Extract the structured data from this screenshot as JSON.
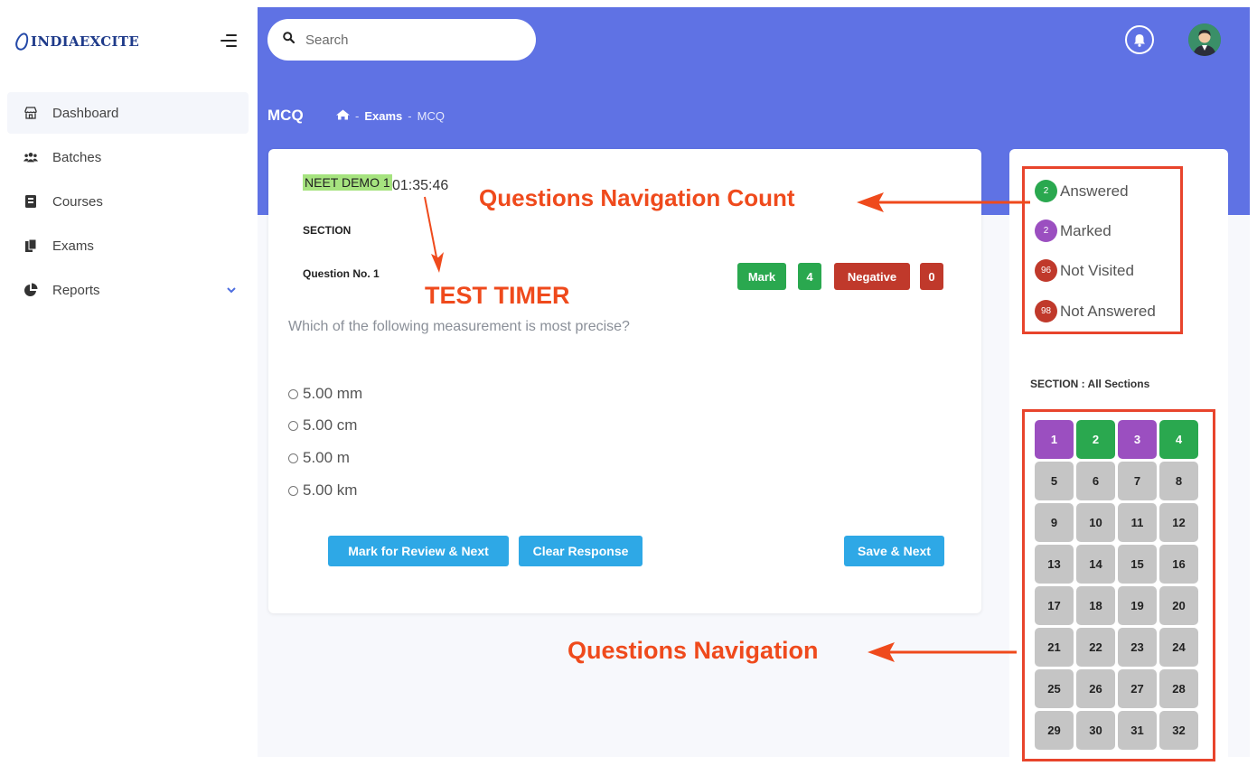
{
  "brand": {
    "name": "INDIAEXCITE"
  },
  "sidebar": {
    "items": [
      {
        "label": "Dashboard",
        "icon": "shop-icon"
      },
      {
        "label": "Batches",
        "icon": "users-icon"
      },
      {
        "label": "Courses",
        "icon": "book-icon"
      },
      {
        "label": "Exams",
        "icon": "copy-icon"
      },
      {
        "label": "Reports",
        "icon": "pie-chart-icon"
      }
    ]
  },
  "search": {
    "placeholder": "Search"
  },
  "header": {
    "title": "MCQ",
    "breadcrumb": [
      "Exams",
      "MCQ"
    ]
  },
  "exam": {
    "name": "NEET DEMO 1",
    "timer": "01:35:46",
    "section": "SECTION",
    "question_no": "Question No. 1",
    "mark_label": "Mark",
    "mark_value": "4",
    "negative_label": "Negative",
    "negative_value": "0",
    "question": "Which of the following measurement is most precise?",
    "options": [
      "5.00 mm",
      "5.00 cm",
      "5.00 m",
      "5.00 km"
    ],
    "buttons": {
      "review": "Mark for Review & Next",
      "clear": "Clear Response",
      "save": "Save & Next"
    }
  },
  "legend": [
    {
      "count": "2",
      "label": "Answered",
      "color": "#2aa84f"
    },
    {
      "count": "2",
      "label": "Marked",
      "color": "#9b4fc0"
    },
    {
      "count": "96",
      "label": "Not Visited",
      "color": "#c0392b"
    },
    {
      "count": "98",
      "label": "Not Answered",
      "color": "#c0392b"
    }
  ],
  "section_label": "SECTION : All Sections",
  "questions": [
    {
      "n": "1",
      "status": "marked"
    },
    {
      "n": "2",
      "status": "answered"
    },
    {
      "n": "3",
      "status": "marked"
    },
    {
      "n": "4",
      "status": "answered"
    },
    {
      "n": "5",
      "status": "unvisited"
    },
    {
      "n": "6",
      "status": "unvisited"
    },
    {
      "n": "7",
      "status": "unvisited"
    },
    {
      "n": "8",
      "status": "unvisited"
    },
    {
      "n": "9",
      "status": "unvisited"
    },
    {
      "n": "10",
      "status": "unvisited"
    },
    {
      "n": "11",
      "status": "unvisited"
    },
    {
      "n": "12",
      "status": "unvisited"
    },
    {
      "n": "13",
      "status": "unvisited"
    },
    {
      "n": "14",
      "status": "unvisited"
    },
    {
      "n": "15",
      "status": "unvisited"
    },
    {
      "n": "16",
      "status": "unvisited"
    },
    {
      "n": "17",
      "status": "unvisited"
    },
    {
      "n": "18",
      "status": "unvisited"
    },
    {
      "n": "19",
      "status": "unvisited"
    },
    {
      "n": "20",
      "status": "unvisited"
    },
    {
      "n": "21",
      "status": "unvisited"
    },
    {
      "n": "22",
      "status": "unvisited"
    },
    {
      "n": "23",
      "status": "unvisited"
    },
    {
      "n": "24",
      "status": "unvisited"
    },
    {
      "n": "25",
      "status": "unvisited"
    },
    {
      "n": "26",
      "status": "unvisited"
    },
    {
      "n": "27",
      "status": "unvisited"
    },
    {
      "n": "28",
      "status": "unvisited"
    },
    {
      "n": "29",
      "status": "unvisited"
    },
    {
      "n": "30",
      "status": "unvisited"
    },
    {
      "n": "31",
      "status": "unvisited"
    },
    {
      "n": "32",
      "status": "unvisited"
    }
  ],
  "status_colors": {
    "answered": "#2aa84f",
    "marked": "#9b4fc0",
    "unvisited": "#c5c5c5"
  },
  "annotations": {
    "nav_count": "Questions Navigation Count",
    "timer": "TEST TIMER",
    "nav": "Questions Navigation"
  },
  "colors": {
    "primary": "#5f72e4",
    "annotation": "#ef4a1c",
    "mark": "#2aa84f",
    "negative": "#c0392b",
    "button": "#2ea8e6"
  }
}
